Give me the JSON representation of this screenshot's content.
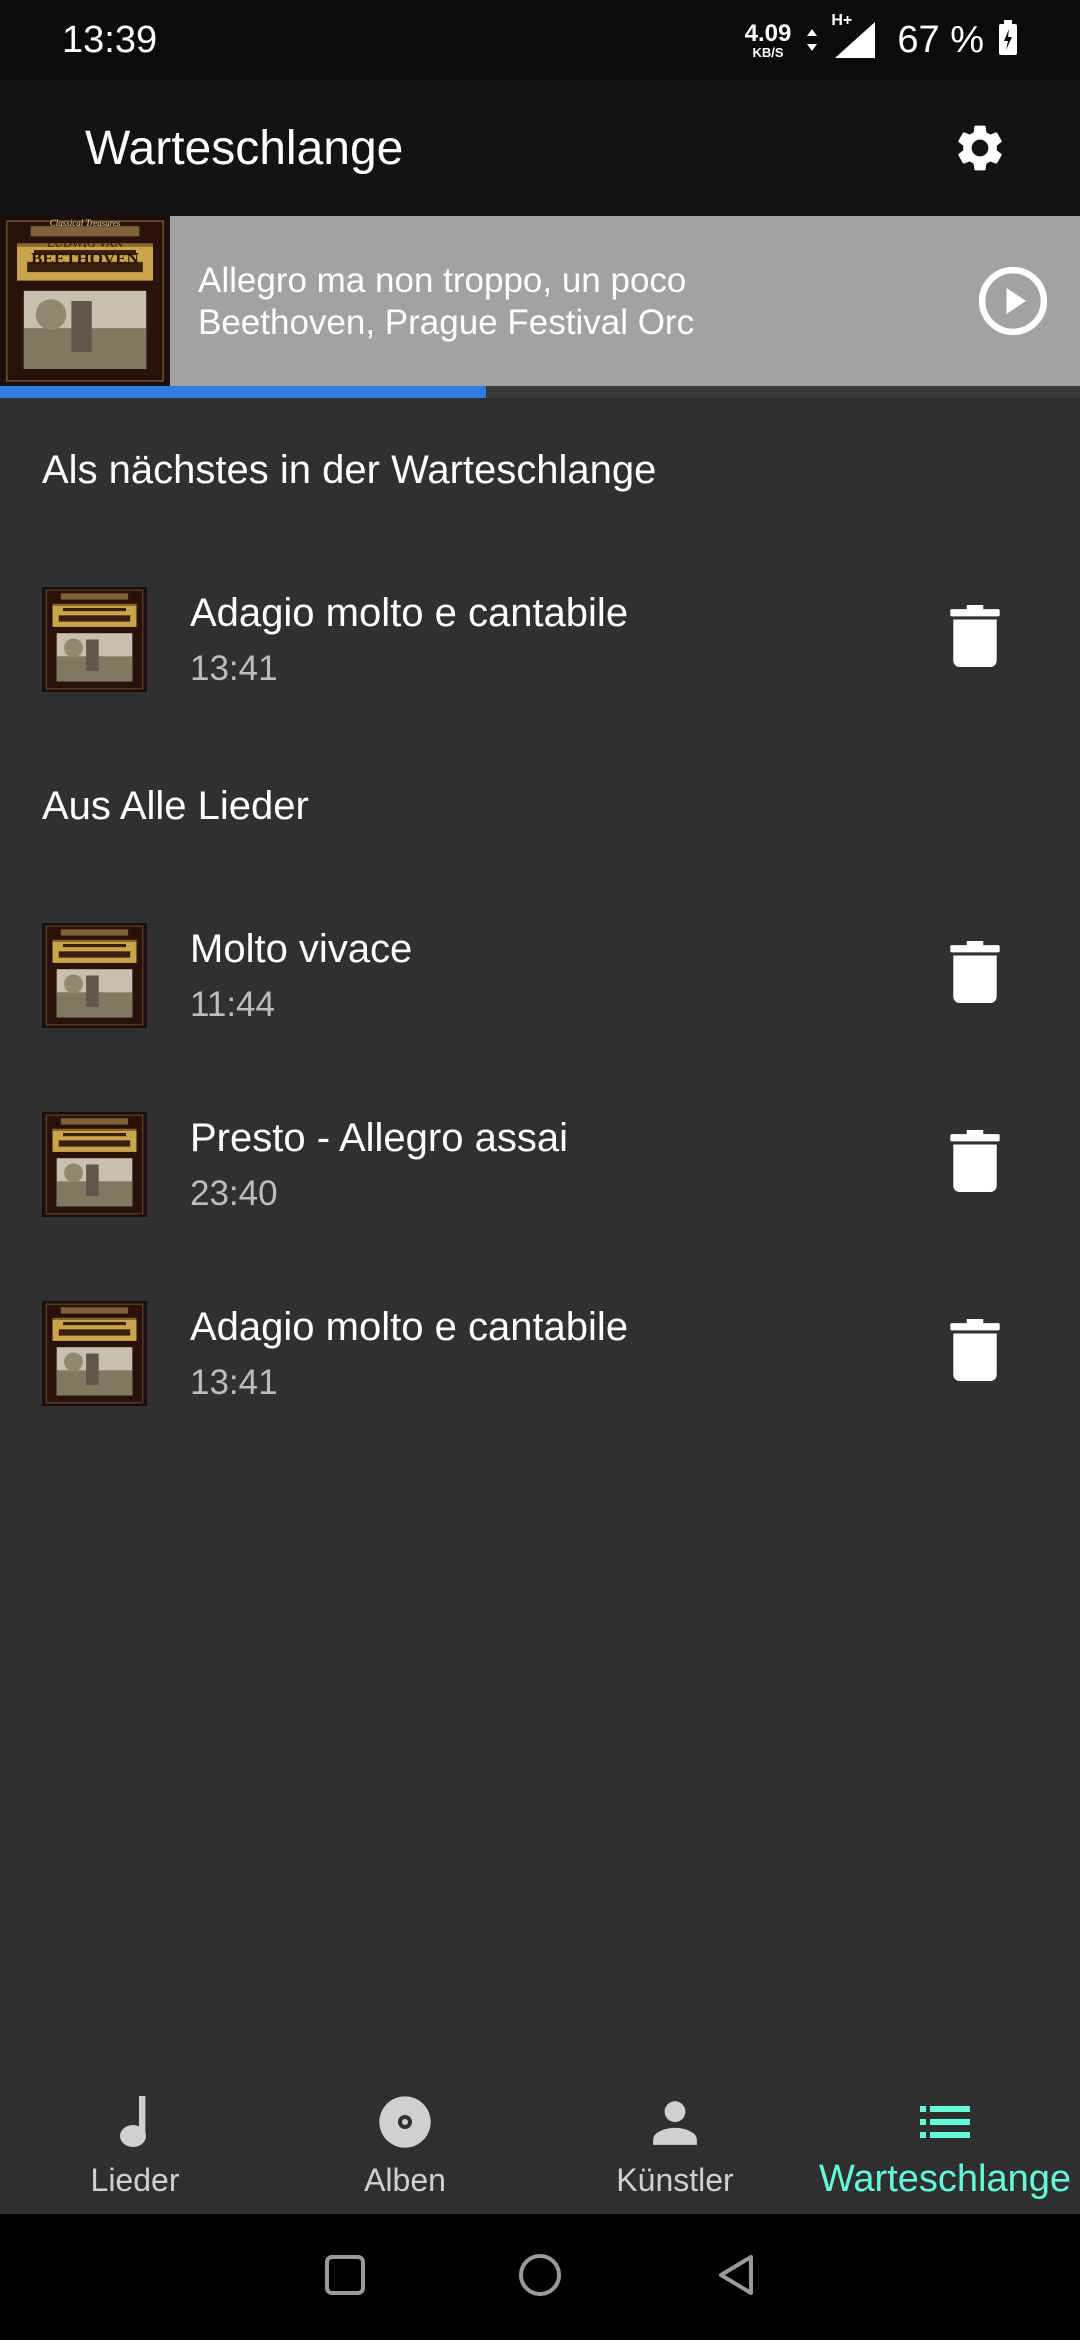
{
  "status_bar": {
    "time": "13:39",
    "net_speed_value": "4.09",
    "net_speed_unit": "KB/S",
    "network_type": "H+",
    "battery": "67 %"
  },
  "app_bar": {
    "title": "Warteschlange",
    "settings_icon": "gear-icon"
  },
  "now_playing": {
    "title": "Allegro ma non troppo, un poco",
    "artist": "Beethoven, Prague Festival Orc",
    "progress": 0.45,
    "cover_text": [
      "Classical Treasures",
      "LUDWIG VAN",
      "BEETHOVEN"
    ]
  },
  "sections": [
    {
      "header": "Als nächstes in der Warteschlange",
      "tracks": [
        {
          "title": "Adagio molto e cantabile",
          "duration": "13:41"
        }
      ]
    },
    {
      "header": "Aus Alle Lieder",
      "tracks": [
        {
          "title": "Molto vivace",
          "duration": "11:44"
        },
        {
          "title": "Presto - Allegro assai",
          "duration": "23:40"
        },
        {
          "title": "Adagio molto e cantabile",
          "duration": "13:41"
        }
      ]
    }
  ],
  "bottom_nav": {
    "items": [
      {
        "label": "Lieder",
        "icon": "music-note-icon"
      },
      {
        "label": "Alben",
        "icon": "album-icon"
      },
      {
        "label": "Künstler",
        "icon": "person-icon"
      },
      {
        "label": "Warteschlange",
        "icon": "queue-list-icon"
      }
    ],
    "active": "Warteschlange"
  },
  "colors": {
    "accent": "#64ffda",
    "progress": "#2f7de1",
    "background": "#303030"
  }
}
